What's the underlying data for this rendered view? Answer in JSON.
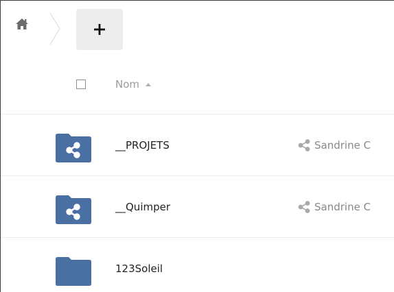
{
  "colors": {
    "folder": "#4a6fa3",
    "folder_dark": "#3f6293",
    "muted_text": "#9b9b9b",
    "share_text": "#888888",
    "button_bg": "#ededed"
  },
  "toolbar": {
    "home_icon": "home-icon",
    "new_button_icon": "plus-icon"
  },
  "header": {
    "name_column": "Nom",
    "sort_icon": "sort-ascending-icon"
  },
  "files": [
    {
      "name": "__PROJETS",
      "shared": true,
      "owner": "Sandrine C",
      "icon": "shared-folder-icon"
    },
    {
      "name": "__Quimper",
      "shared": true,
      "owner": "Sandrine C",
      "icon": "shared-folder-icon"
    },
    {
      "name": "123Soleil",
      "shared": false,
      "owner": "",
      "icon": "folder-icon"
    }
  ]
}
